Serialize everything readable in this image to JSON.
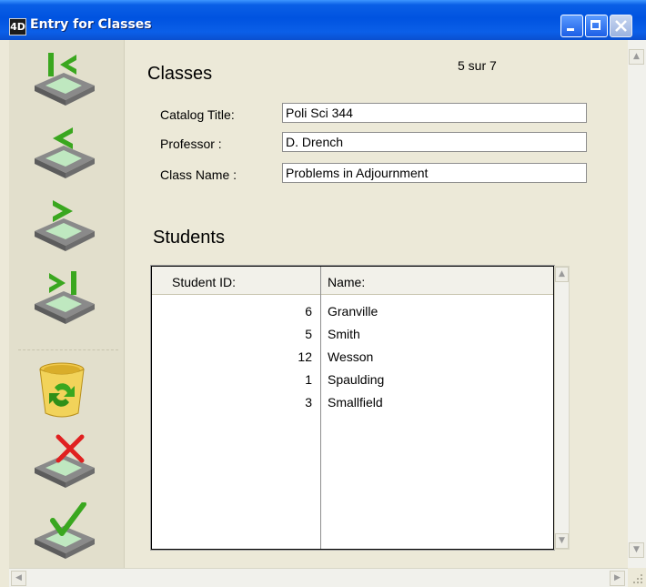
{
  "window": {
    "title": "Entry for Classes",
    "app_icon_text": "4D"
  },
  "toolbar": {
    "buttons": [
      {
        "name": "first-record",
        "icon": "first-record-icon"
      },
      {
        "name": "previous-record",
        "icon": "previous-record-icon"
      },
      {
        "name": "next-record",
        "icon": "next-record-icon"
      },
      {
        "name": "last-record",
        "icon": "last-record-icon"
      },
      {
        "name": "delete-record",
        "icon": "recycle-bin-icon"
      },
      {
        "name": "cancel",
        "icon": "cancel-x-icon"
      },
      {
        "name": "accept",
        "icon": "accept-check-icon"
      }
    ]
  },
  "form": {
    "heading": "Classes",
    "record_position": "5 sur 7",
    "fields": {
      "catalog_title": {
        "label": "Catalog Title:",
        "value": "Poli Sci 344"
      },
      "professor": {
        "label": "Professor :",
        "value": "D. Drench"
      },
      "class_name": {
        "label": "Class Name :",
        "value": "Problems in Adjournment"
      }
    }
  },
  "students": {
    "heading": "Students",
    "columns": [
      "Student ID:",
      "Name:"
    ],
    "rows": [
      {
        "id": "6",
        "name": "Granville"
      },
      {
        "id": "5",
        "name": "Smith"
      },
      {
        "id": "12",
        "name": "Wesson"
      },
      {
        "id": "1",
        "name": "Spaulding"
      },
      {
        "id": "3",
        "name": "Smallfield"
      }
    ]
  },
  "colors": {
    "title_bar": "#0053e0",
    "window_bg": "#ece9d8",
    "arrow_green": "#3aa71f",
    "delete_red": "#e02020"
  }
}
